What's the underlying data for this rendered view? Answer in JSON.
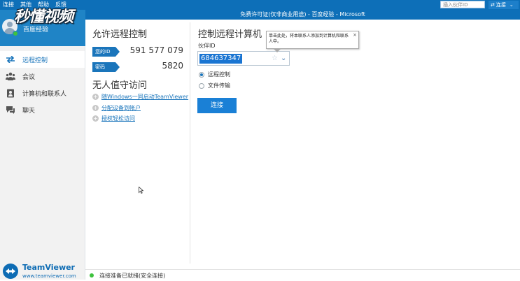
{
  "menu": [
    "连接",
    "其他",
    "帮助",
    "反馈"
  ],
  "top": {
    "partner_placeholder": "插入伙伴ID",
    "connect_label": "连接"
  },
  "title": "免费许可证(仅非商业用途) - 百度经验 - Microsoft",
  "watermark": "秒懂视频",
  "profile": {
    "name": "百度经验"
  },
  "sidebar": {
    "items": [
      {
        "label": "远程控制",
        "icon": "arrows-icon",
        "active": true
      },
      {
        "label": "会议",
        "icon": "people-icon",
        "active": false
      },
      {
        "label": "计算机和联系人",
        "icon": "contacts-icon",
        "active": false
      },
      {
        "label": "聊天",
        "icon": "chat-icon",
        "active": false
      }
    ]
  },
  "brand": {
    "name": "TeamViewer",
    "url": "www.teamviewer.com"
  },
  "allow": {
    "title": "允许远程控制",
    "id_label": "您的ID",
    "id_value": "591 577 079",
    "pwd_label": "密码",
    "pwd_value": "5820"
  },
  "unattended": {
    "title": "无人值守访问",
    "links": [
      "随Windows一同启动TeamViewer",
      "分配设备到帐户",
      "授权轻松访问"
    ]
  },
  "control": {
    "title": "控制远程计算机",
    "partner_label": "伙伴ID",
    "partner_value": "684637347",
    "tooltip": "单击此处，将本联系人添加到计算机和联系人中。",
    "options": [
      {
        "label": "远程控制",
        "selected": true
      },
      {
        "label": "文件传输",
        "selected": false
      }
    ],
    "connect_button": "连接"
  },
  "status": {
    "text": "连接准备已就绪(安全连接)",
    "color": "#3ec23e"
  },
  "colors": {
    "accent": "#1a75bb",
    "titlebar": "#0d6fb8"
  }
}
